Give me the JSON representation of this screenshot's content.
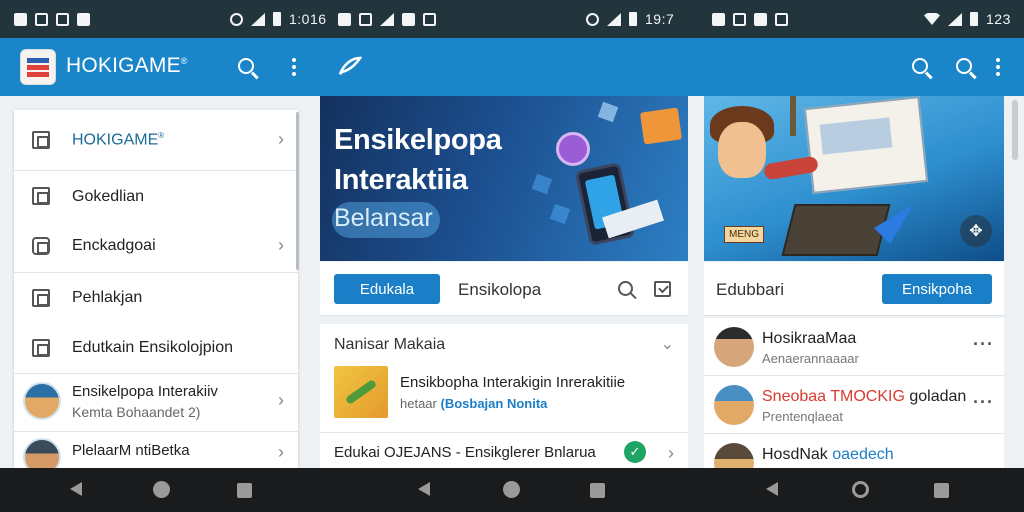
{
  "status_bar": {
    "time_1": "1:016",
    "time_2": "19:7",
    "time_3": "123"
  },
  "app_bar": {
    "title": "HOKIGAME",
    "trademark": "®",
    "icons": [
      "search-icon",
      "more-icon",
      "feather-icon",
      "search-icon",
      "search-icon",
      "more-icon"
    ]
  },
  "drawer": {
    "items": [
      {
        "label": "HOKIGAME",
        "trademark": "®",
        "icon": "square-icon",
        "chevron": true
      },
      {
        "label": "Gokedlian",
        "icon": "square-icon",
        "chevron": false
      },
      {
        "label": "Enckadgoai",
        "icon": "camera-icon",
        "chevron": true
      },
      {
        "label": "Pehlakjan",
        "icon": "square-icon",
        "chevron": false
      },
      {
        "label": "Edutkain Ensikolojpion",
        "icon": "image-icon",
        "chevron": false
      }
    ],
    "profiles": [
      {
        "name": "Ensikelpopa Interakiiv",
        "sub": "Kemta Bohaandet 2)"
      },
      {
        "name": "PlelaarM ntiBetka",
        "sub": ""
      }
    ]
  },
  "hero_main": {
    "line1": "Ensikelpopa",
    "line2": "Interaktiia",
    "line3": "Belansar"
  },
  "card_bar_main": {
    "button": "Edukala",
    "label": "Ensikolopa"
  },
  "list_card": {
    "header": "Nanisar Makaia",
    "item_title": "Ensikbopha Interakigin Inrerakitiie",
    "item_sub_prefix": "hetaar",
    "item_sub_highlight": "(Bosbajan Nonita",
    "row2": "Edukai OJEJANS - Ensikglerer Bnlarua"
  },
  "hero_right": {
    "badge": "MENG"
  },
  "card_bar_right": {
    "label": "Edubbari",
    "button": "Ensikpoha"
  },
  "users": [
    {
      "name": "HosikraaMaa",
      "sub": "Aenaerannaaaar"
    },
    {
      "name_red": "Sneobaa TMOCKIG",
      "name_rest": " goladan",
      "sub": "Prentenqlaeat"
    },
    {
      "name_plain": "HosdNak ",
      "name_blue": "oaedech",
      "sub": ""
    }
  ],
  "colors": {
    "appbar": "#1a86c9",
    "statusbar": "#22343c",
    "accent_button": "#1a7fc6",
    "check": "#1fa463"
  }
}
